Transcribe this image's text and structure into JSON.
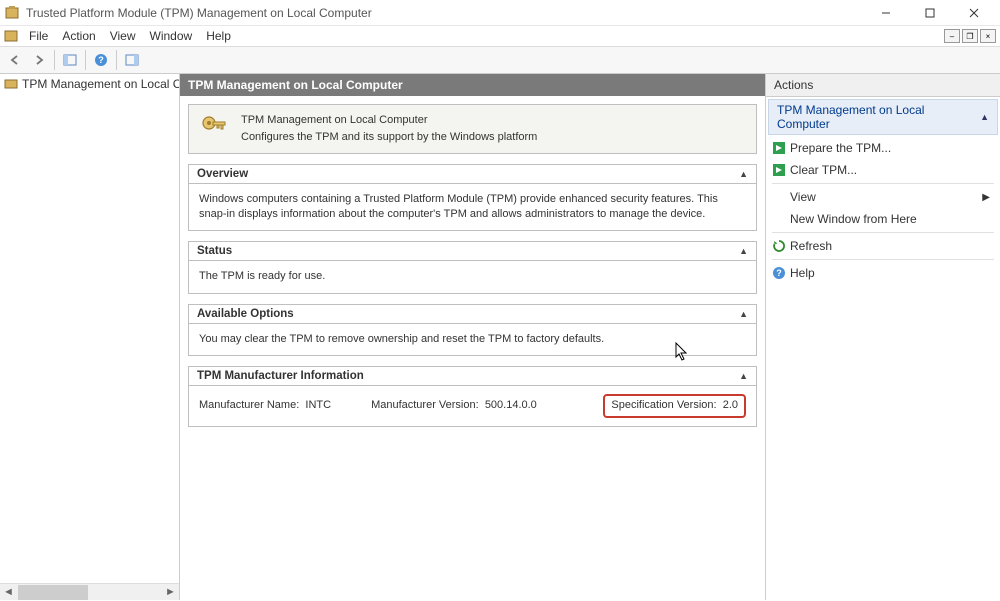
{
  "window": {
    "title": "Trusted Platform Module (TPM) Management on Local Computer"
  },
  "menu": {
    "file": "File",
    "action": "Action",
    "view": "View",
    "window": "Window",
    "help": "Help"
  },
  "tree": {
    "root": "TPM Management on Local Comp"
  },
  "center": {
    "header": "TPM Management on Local Computer",
    "intro_title": "TPM Management on Local Computer",
    "intro_desc": "Configures the TPM and its support by the Windows platform",
    "panels": {
      "overview": {
        "title": "Overview",
        "body": "Windows computers containing a Trusted Platform Module (TPM) provide enhanced security features. This snap-in displays information about the computer's TPM and allows administrators to manage the device."
      },
      "status": {
        "title": "Status",
        "body": "The TPM is ready for use."
      },
      "options": {
        "title": "Available Options",
        "body": "You may clear the TPM to remove ownership and reset the TPM to factory defaults."
      },
      "manufacturer": {
        "title": "TPM Manufacturer Information",
        "name_label": "Manufacturer Name:",
        "name_value": "INTC",
        "version_label": "Manufacturer Version:",
        "version_value": "500.14.0.0",
        "spec_label": "Specification Version:",
        "spec_value": "2.0"
      }
    }
  },
  "actions": {
    "header": "Actions",
    "group": "TPM Management on Local Computer",
    "items": {
      "prepare": "Prepare the TPM...",
      "clear": "Clear TPM...",
      "view": "View",
      "newwindow": "New Window from Here",
      "refresh": "Refresh",
      "help": "Help"
    }
  }
}
